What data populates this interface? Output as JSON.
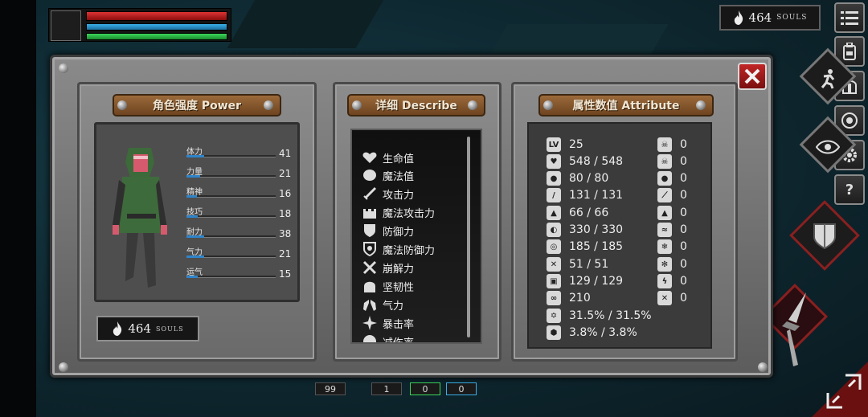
{
  "hud": {
    "souls_value": "464",
    "souls_label": "SOULS"
  },
  "right_menu": {
    "help_label": "?"
  },
  "power_panel": {
    "title": "角色强度 Power",
    "stats": [
      {
        "name": "体力",
        "value": "41",
        "level": 0.2
      },
      {
        "name": "力量",
        "value": "21",
        "level": 0.15
      },
      {
        "name": "精神",
        "value": "16",
        "level": 0.12
      },
      {
        "name": "技巧",
        "value": "18",
        "level": 0.13
      },
      {
        "name": "耐力",
        "value": "38",
        "level": 0.2
      },
      {
        "name": "气力",
        "value": "21",
        "level": 0.2
      },
      {
        "name": "运气",
        "value": "15",
        "level": 0.13
      }
    ],
    "souls_value": "464",
    "souls_label": "SOULS"
  },
  "describe_panel": {
    "title": "详细 Describe",
    "items": [
      {
        "label": "生命值",
        "icon": "heart-icon"
      },
      {
        "label": "魔法值",
        "icon": "brain-icon"
      },
      {
        "label": "攻击力",
        "icon": "sword-icon"
      },
      {
        "label": "魔法攻击力",
        "icon": "castle-icon"
      },
      {
        "label": "防御力",
        "icon": "shield-icon"
      },
      {
        "label": "魔法防御力",
        "icon": "magic-shield-icon"
      },
      {
        "label": "崩解力",
        "icon": "break-icon"
      },
      {
        "label": "坚韧性",
        "icon": "helmet-icon"
      },
      {
        "label": "气力",
        "icon": "lungs-icon"
      },
      {
        "label": "暴击率",
        "icon": "star-burst-icon"
      },
      {
        "label": "减伤率",
        "icon": "damage-reduction-icon"
      }
    ]
  },
  "attribute_panel": {
    "title": "属性数值 Attribute",
    "left": [
      {
        "icon": "lv-icon",
        "icon_text": "LV",
        "value": "25"
      },
      {
        "icon": "heart-icon",
        "icon_text": "♥",
        "value": "548 / 548"
      },
      {
        "icon": "brain-icon",
        "icon_text": "●",
        "value": "80 / 80"
      },
      {
        "icon": "sword-icon",
        "icon_text": "/",
        "value": "131 / 131"
      },
      {
        "icon": "castle-icon",
        "icon_text": "▲",
        "value": "66 / 66"
      },
      {
        "icon": "shield-icon",
        "icon_text": "◐",
        "value": "330 / 330"
      },
      {
        "icon": "magic-shield-icon",
        "icon_text": "◎",
        "value": "185 / 185"
      },
      {
        "icon": "break-icon",
        "icon_text": "✕",
        "value": "51 / 51"
      },
      {
        "icon": "helmet-icon",
        "icon_text": "▣",
        "value": "129 / 129"
      },
      {
        "icon": "lungs-icon",
        "icon_text": "∞",
        "value": "210"
      },
      {
        "icon": "star-burst-icon",
        "icon_text": "✡",
        "value": "31.5% / 31.5%"
      },
      {
        "icon": "damage-reduction-icon",
        "icon_text": "⬢",
        "value": "3.8% / 3.8%"
      }
    ],
    "right": [
      {
        "icon": "skull-icon",
        "icon_text": "☠",
        "value": "0"
      },
      {
        "icon": "bones-icon",
        "icon_text": "☠",
        "value": "0"
      },
      {
        "icon": "blood-drop-icon",
        "icon_text": "●",
        "value": "0"
      },
      {
        "icon": "slash-icon",
        "icon_text": "⟋",
        "value": "0"
      },
      {
        "icon": "fire-icon",
        "icon_text": "▲",
        "value": "0"
      },
      {
        "icon": "wind-icon",
        "icon_text": "≈",
        "value": "0"
      },
      {
        "icon": "frost-icon",
        "icon_text": "❄",
        "value": "0"
      },
      {
        "icon": "ice-icon",
        "icon_text": "✻",
        "value": "0"
      },
      {
        "icon": "lightning-icon",
        "icon_text": "ϟ",
        "value": "0"
      },
      {
        "icon": "holy-icon",
        "icon_text": "✕",
        "value": "0"
      }
    ]
  },
  "bottom_bar": {
    "count": "99",
    "slot1": "1",
    "slot2": "0",
    "slot3": "0"
  }
}
